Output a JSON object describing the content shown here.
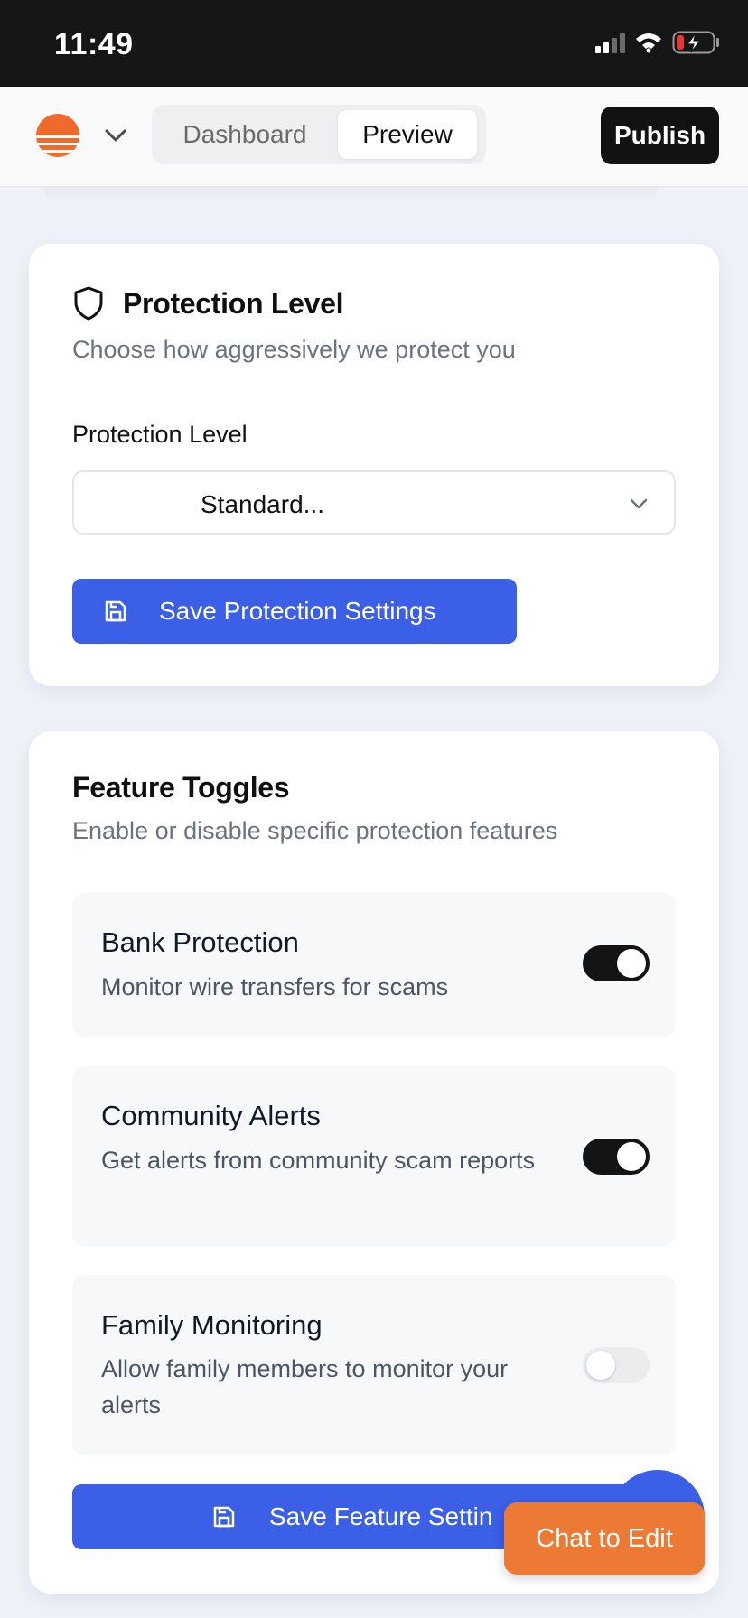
{
  "status_bar": {
    "time": "11:49"
  },
  "nav": {
    "tabs": [
      {
        "label": "Dashboard",
        "active": false
      },
      {
        "label": "Preview",
        "active": true
      }
    ],
    "publish_label": "Publish"
  },
  "protection_card": {
    "title": "Protection Level",
    "subtitle": "Choose how aggressively we protect you",
    "field_label": "Protection Level",
    "select_value": "Standard...",
    "save_label": "Save Protection Settings"
  },
  "features_card": {
    "title": "Feature Toggles",
    "subtitle": "Enable or disable specific protection features",
    "toggles": [
      {
        "title": "Bank Protection",
        "description": "Monitor wire transfers for scams",
        "enabled": true
      },
      {
        "title": "Community Alerts",
        "description": "Get alerts from community scam reports",
        "enabled": true
      },
      {
        "title": "Family Monitoring",
        "description": "Allow family members to monitor your alerts",
        "enabled": false
      }
    ],
    "save_label": "Save Feature Settin"
  },
  "chat_to_edit_label": "Chat to Edit",
  "colors": {
    "accent_blue": "#3b5fe6",
    "brand_orange": "#ef6b2c",
    "chat_orange": "#ec7a34",
    "toggle_on": "#141414"
  }
}
